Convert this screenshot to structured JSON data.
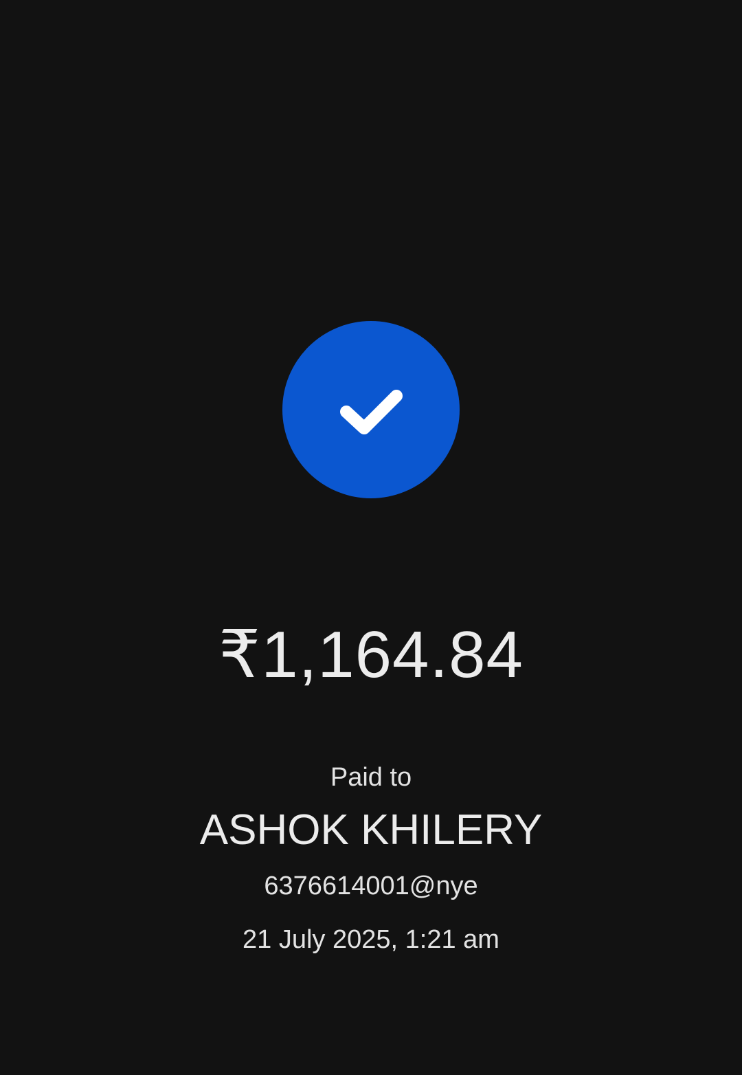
{
  "colors": {
    "background": "#121212",
    "accent": "#0b57d0",
    "text": "#ececec"
  },
  "status": {
    "icon": "check-icon"
  },
  "payment": {
    "amount": "₹1,164.84",
    "paid_to_label": "Paid to",
    "payee_name": "ASHOK KHILERY",
    "upi_id": "6376614001@nye",
    "datetime": "21 July 2025, 1:21 am"
  }
}
